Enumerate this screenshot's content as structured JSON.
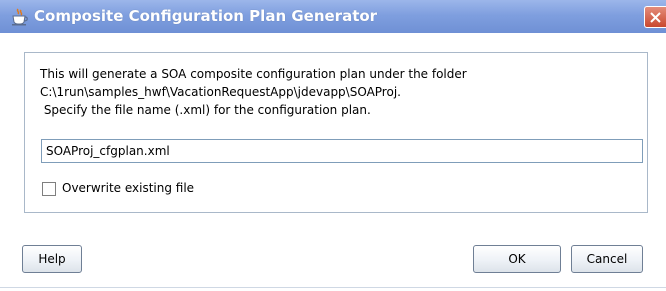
{
  "window": {
    "title": "Composite Configuration Plan Generator",
    "icon": "java-cup-icon",
    "close_icon": "close-icon"
  },
  "message": {
    "line1": "This will generate a SOA composite configuration plan under the folder",
    "line2": "C:\\1run\\samples_hwf\\VacationRequestApp\\jdevapp\\SOAProj.",
    "line3": " Specify the file name (.xml) for the configuration plan."
  },
  "file_name": {
    "value": "SOAProj_cfgplan.xml"
  },
  "overwrite": {
    "label": "Overwrite existing file",
    "checked": false
  },
  "buttons": {
    "help": "Help",
    "ok": "OK",
    "cancel": "Cancel"
  }
}
